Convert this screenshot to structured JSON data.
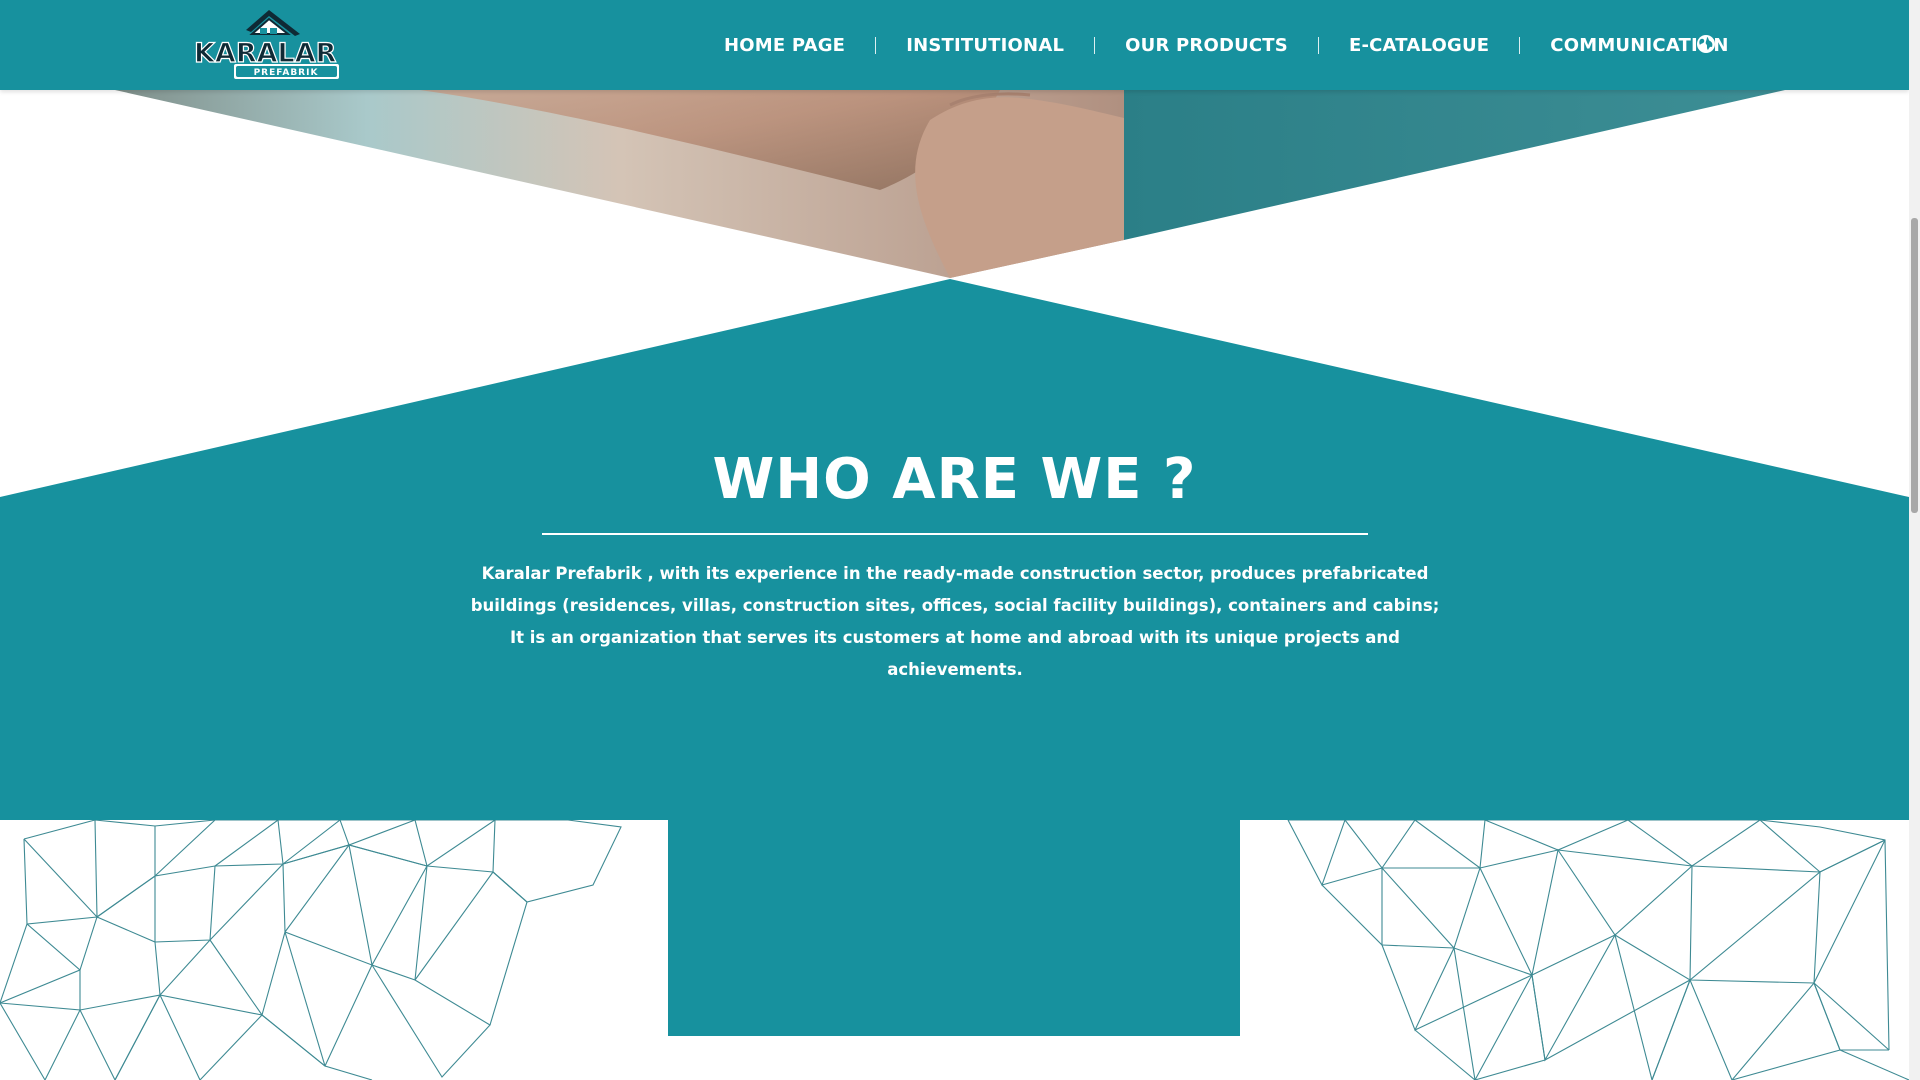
{
  "brand": {
    "logo_main": "KARALAR",
    "logo_sub": "PREFABRIK"
  },
  "nav": {
    "items": [
      {
        "label": "HOME PAGE"
      },
      {
        "label": "INSTITUTIONAL"
      },
      {
        "label": "OUR PRODUCTS"
      },
      {
        "label": "E-CATALOGUE"
      },
      {
        "label": "COMMUNICATION"
      }
    ],
    "language_icon": "globe-icon"
  },
  "about": {
    "title": "WHO ARE WE ?",
    "brand_name": "Karalar Prefabrik",
    "body": " , with its experience in the ready-made construction sector, produces prefabricated buildings (residences, villas, construction sites, offices, social facility buildings), containers and cabins; It is an organization that serves its customers at home and abroad with its unique projects and achievements."
  },
  "colors": {
    "primary": "#17919e",
    "white": "#ffffff",
    "pattern_line": "#3e8a93"
  }
}
